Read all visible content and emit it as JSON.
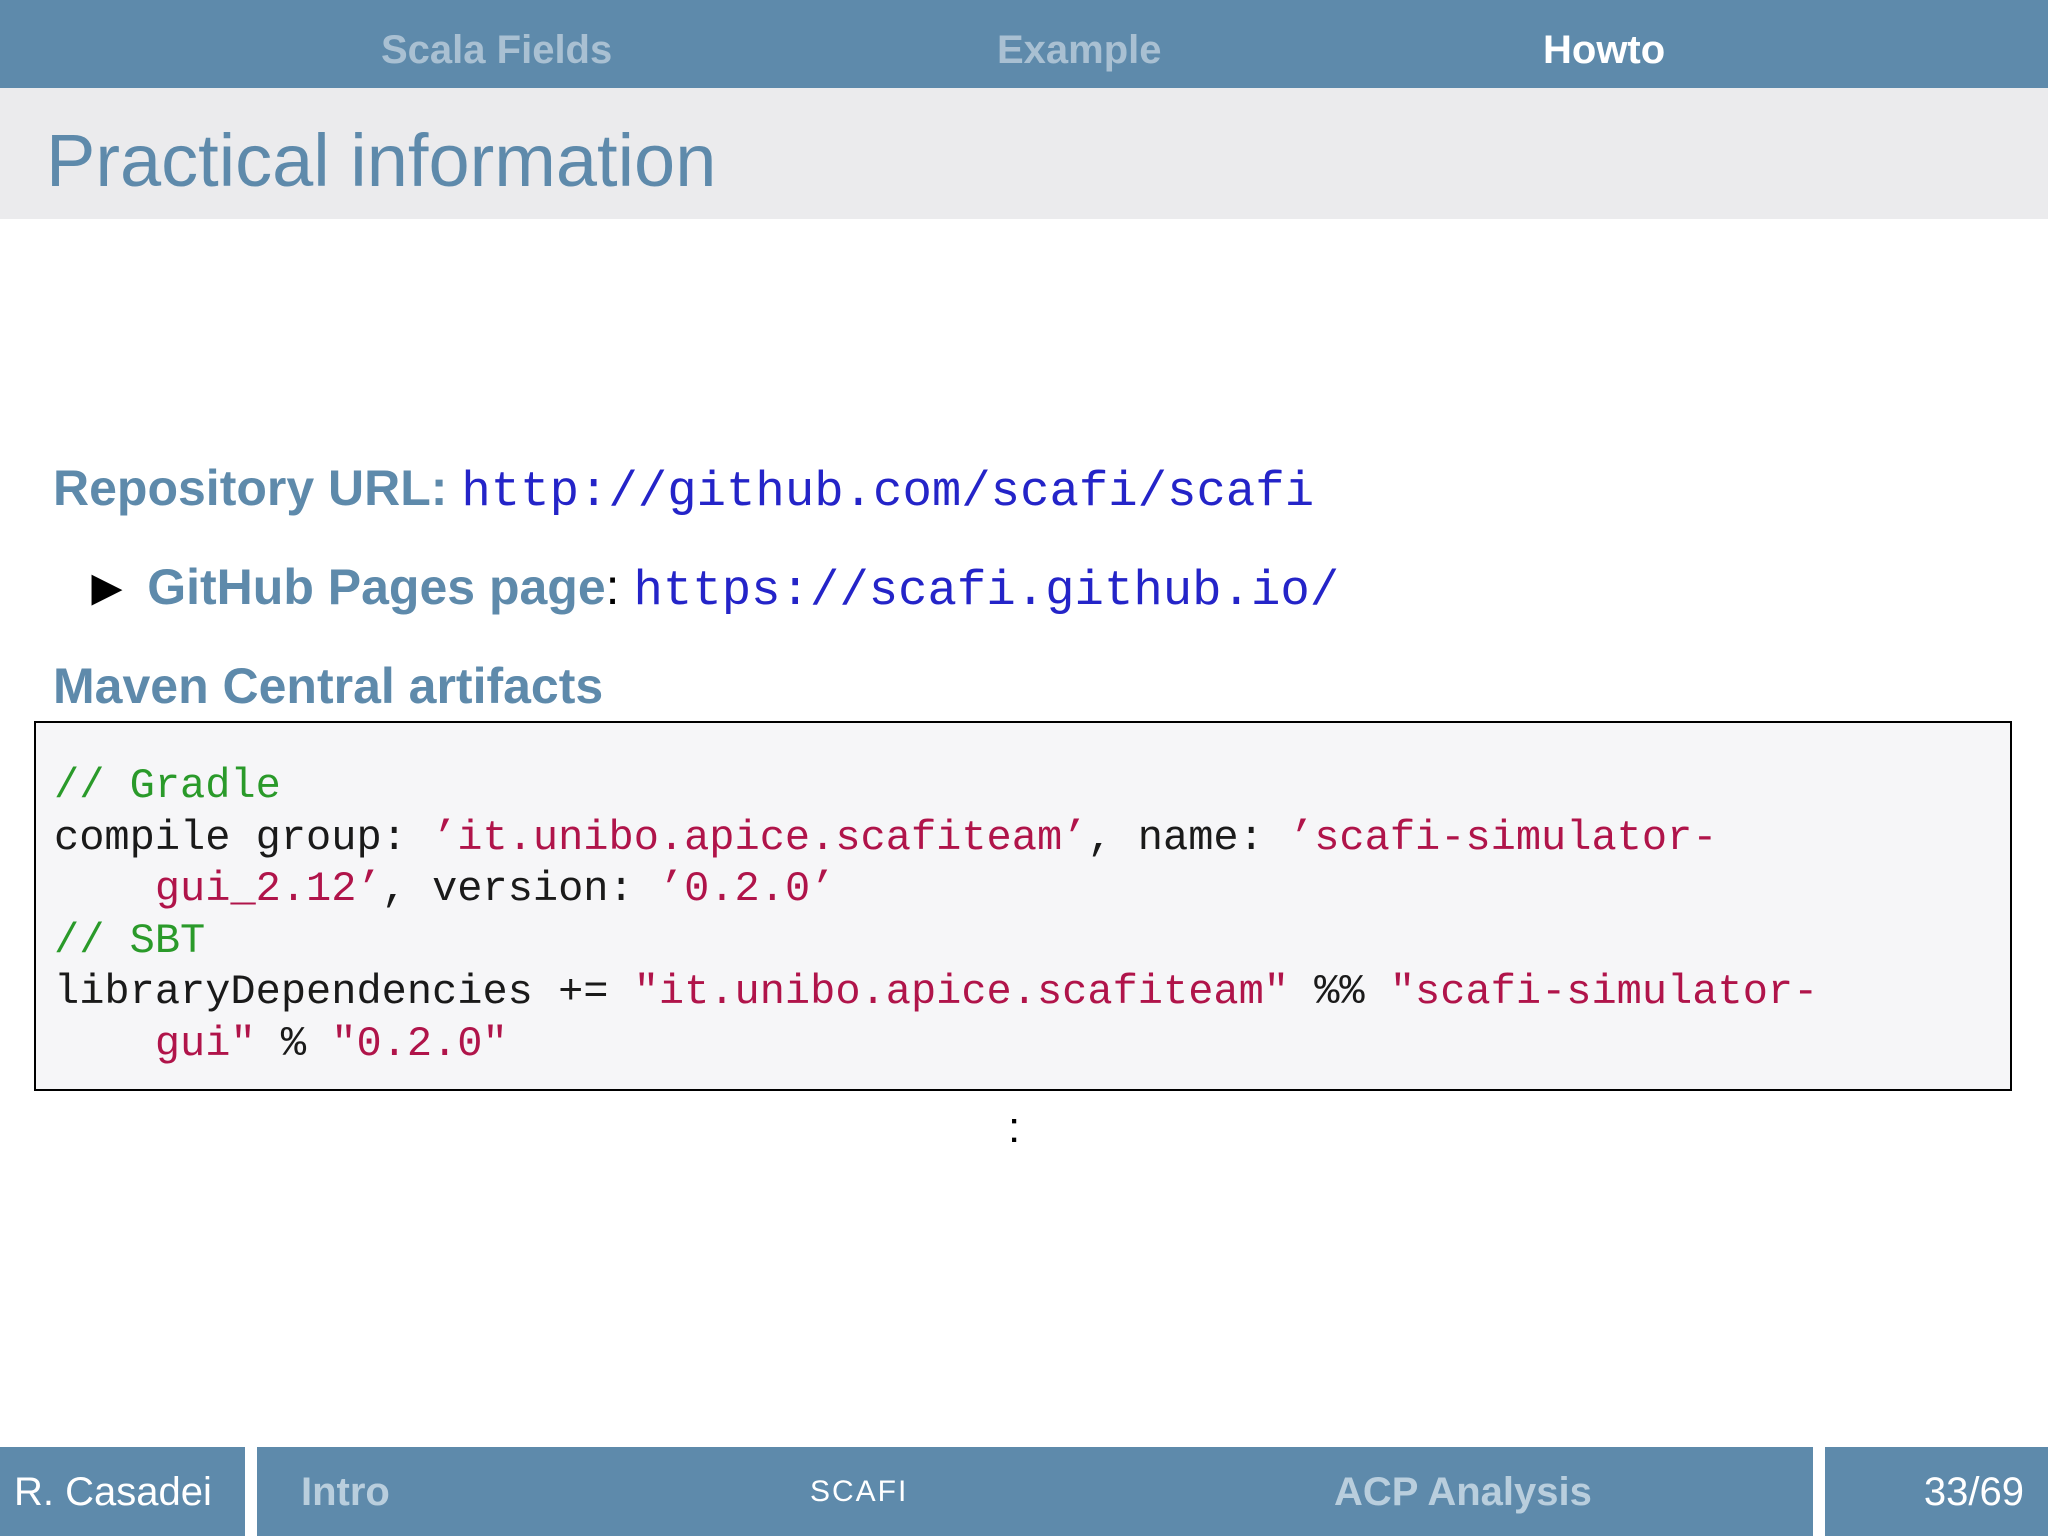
{
  "nav": {
    "sections": [
      {
        "label": "Scala Fields",
        "active": false
      },
      {
        "label": "Example",
        "active": false
      },
      {
        "label": "Howto",
        "active": true
      }
    ]
  },
  "frame": {
    "title": "Practical information"
  },
  "content": {
    "repo_label": "Repository URL:",
    "repo_url": "http://github.com/scafi/scafi",
    "pages_label": "GitHub Pages page",
    "pages_colon": ":",
    "pages_url": "https://scafi.github.io/",
    "maven_heading": "Maven Central artifacts",
    "code": {
      "gradle_comment": "// Gradle",
      "gradle_prefix": "compile group: ",
      "gradle_group": "’it.unibo.apice.scafiteam’",
      "gradle_mid": ", name: ",
      "gradle_name_1": "’scafi-simulator-",
      "gradle_name_2": "gui_2.12’",
      "gradle_mid2": ", version: ",
      "gradle_version": "’0.2.0’",
      "sbt_comment": "// SBT",
      "sbt_prefix": "libraryDependencies += ",
      "sbt_group": "\"it.unibo.apice.scafiteam\"",
      "sbt_op1": " %% ",
      "sbt_name_1": "\"scafi-simulator-",
      "sbt_name_2": "gui\"",
      "sbt_op2": " % ",
      "sbt_version": "\"0.2.0\""
    },
    "continuation": ":"
  },
  "footer": {
    "author": "R. Casadei",
    "intro": "Intro",
    "short_title": "SCAFI",
    "section": "ACP Analysis",
    "page": "33/69"
  },
  "colors": {
    "accent": "#5e8aab",
    "title_band": "#ebebed",
    "link": "#2424c8",
    "code_string": "#b0144a",
    "code_comment": "#2a9a2a"
  }
}
